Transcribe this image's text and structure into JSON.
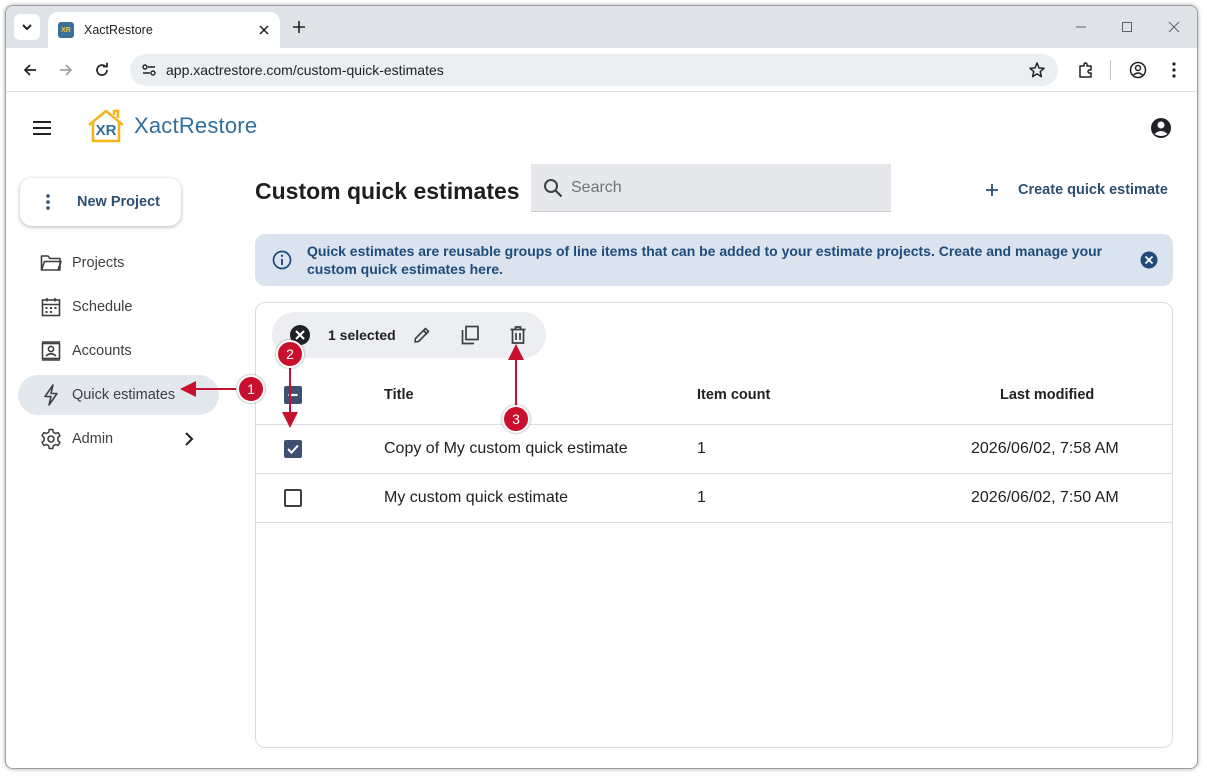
{
  "browser": {
    "tab_title": "XactRestore",
    "favicon_text": "XR",
    "url": "app.xactrestore.com/custom-quick-estimates"
  },
  "app": {
    "brand_mark": "XR",
    "brand_name": "XactRestore",
    "brand_color": "#2f6e9e",
    "accent_color": "#2c4f72"
  },
  "sidebar": {
    "new_project_label": "New Project",
    "items": [
      {
        "label": "Projects",
        "icon": "folder-icon",
        "active": false
      },
      {
        "label": "Schedule",
        "icon": "calendar-icon",
        "active": false
      },
      {
        "label": "Accounts",
        "icon": "contact-card-icon",
        "active": false
      },
      {
        "label": "Quick estimates",
        "icon": "lightning-icon",
        "active": true
      },
      {
        "label": "Admin",
        "icon": "gear-icon",
        "active": false,
        "has_chevron": true
      }
    ]
  },
  "main": {
    "title": "Custom quick estimates",
    "search_placeholder": "Search",
    "create_label": "Create quick estimate",
    "info_text": "Quick estimates are reusable groups of line items that can be added to your estimate projects. Create and manage your custom quick estimates here.",
    "selection_label": "1 selected",
    "table": {
      "columns": [
        "Title",
        "Item count",
        "Last modified"
      ],
      "rows": [
        {
          "title": "Copy of My custom quick estimate",
          "count": "1",
          "modified": "2026/06/02, 7:58 AM",
          "checked": true
        },
        {
          "title": "My custom quick estimate",
          "count": "1",
          "modified": "2026/06/02, 7:50 AM",
          "checked": false
        }
      ]
    }
  },
  "annotations": {
    "badges": [
      "1",
      "2",
      "3"
    ],
    "color": "#c8102e"
  }
}
